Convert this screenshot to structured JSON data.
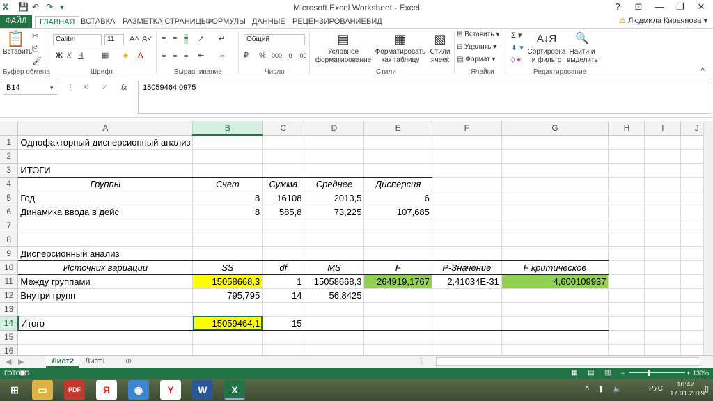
{
  "window": {
    "title": "Microsoft Excel Worksheet - Excel",
    "controls": [
      "?",
      "⊡",
      "—",
      "❐",
      "✕"
    ]
  },
  "tabs": {
    "file": "ФАЙЛ",
    "items": [
      "ГЛАВНАЯ",
      "ВСТАВКА",
      "РАЗМЕТКА СТРАНИЦЫ",
      "ФОРМУЛЫ",
      "ДАННЫЕ",
      "РЕЦЕНЗИРОВАНИЕ",
      "ВИД"
    ],
    "user": "Людмила Кирьянова"
  },
  "ribbon": {
    "paste": "Вставить",
    "font_name": "Calibri",
    "font_size": "11",
    "number_format": "Общий",
    "conditional_formatting": [
      "Условное",
      "форматирование"
    ],
    "format_as_table": [
      "Форматировать",
      "как таблицу"
    ],
    "cell_styles": [
      "Стили",
      "ячеек"
    ],
    "insert": "Вставить",
    "delete": "Удалить",
    "format": "Формат",
    "sort_filter": [
      "Сортировка",
      "и фильтр"
    ],
    "find_select": [
      "Найти и",
      "выделить"
    ],
    "groups": [
      "Буфер обмена",
      "Шрифт",
      "Выравнивание",
      "Число",
      "Стили",
      "Ячейки",
      "Редактирование"
    ]
  },
  "formula_bar": {
    "name_box": "B14",
    "fx": "fx",
    "value": "15059464,0975"
  },
  "columns": [
    "A",
    "B",
    "C",
    "D",
    "E",
    "F",
    "G",
    "H",
    "I",
    "J"
  ],
  "rows": {
    "r1": {
      "num": "1",
      "a": "Однофакторный дисперсионный анализ"
    },
    "r2": {
      "num": "2"
    },
    "r3": {
      "num": "3",
      "a": "ИТОГИ"
    },
    "r4": {
      "num": "4",
      "a": "Группы",
      "b": "Счет",
      "c": "Сумма",
      "d": "Среднее",
      "e": "Дисперсия"
    },
    "r5": {
      "num": "5",
      "a": "Год",
      "b": "8",
      "c": "16108",
      "d": "2013,5",
      "e": "6"
    },
    "r6": {
      "num": "6",
      "a": "Динамика ввода в дейс",
      "b": "8",
      "c": "585,8",
      "d": "73,225",
      "e": "107,685"
    },
    "r7": {
      "num": "7"
    },
    "r8": {
      "num": "8"
    },
    "r9": {
      "num": "9",
      "a": "Дисперсионный анализ"
    },
    "r10": {
      "num": "10",
      "a": "Источник вариации",
      "b": "SS",
      "c": "df",
      "d": "MS",
      "e": "F",
      "f": "P-Значение",
      "g": "F критическое"
    },
    "r11": {
      "num": "11",
      "a": "Между группами",
      "b": "15058668,3",
      "c": "1",
      "d": "15058668,3",
      "e": "264919,1767",
      "f": "2,41034E-31",
      "g": "4,600109937"
    },
    "r12": {
      "num": "12",
      "a": "Внутри групп",
      "b": "795,795",
      "c": "14",
      "d": "56,8425"
    },
    "r13": {
      "num": "13"
    },
    "r14": {
      "num": "14",
      "a": "Итого",
      "b": "15059464,1",
      "c": "15"
    },
    "r15": {
      "num": "15"
    },
    "r16": {
      "num": "16"
    }
  },
  "sheets": [
    "Лист2",
    "Лист1"
  ],
  "status": {
    "ready": "ГОТОВО",
    "zoom": "130%"
  },
  "taskbar": {
    "lang": "РУС",
    "time": "16:47",
    "date": "17.01.2019"
  }
}
